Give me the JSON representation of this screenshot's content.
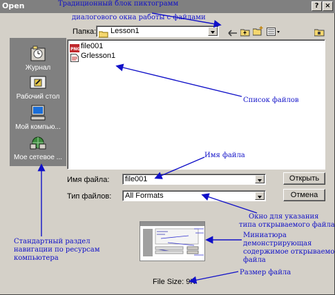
{
  "dialog": {
    "title": "Open",
    "help_glyph": "?",
    "close_glyph": "×",
    "lookin_label": "Папка:",
    "lookin_value": "Lesson1",
    "files": [
      {
        "name": "file001",
        "icon": "png-file-icon"
      },
      {
        "name": "Grlesson1",
        "icon": "document-icon"
      }
    ],
    "places": [
      "Журнал",
      "Рабочий стол",
      "Мой компью...",
      "Мое сетевое ..."
    ],
    "filename_label": "Имя файла:",
    "filename_value": "file001",
    "filetype_label": "Тип файлов:",
    "filetype_value": "All Formats",
    "open_button": "Открыть",
    "cancel_button": "Отмена",
    "file_size": "File Size: 9K"
  },
  "annotations": {
    "toolbar_line1": "Традиционный блок пиктограмм",
    "toolbar_line2": "диалогового окна работы с файлами",
    "file_list": "Список файлов",
    "file_name": "Имя файла",
    "file_type_line1": "Окно для указания",
    "file_type_line2": "типа открываемого файла",
    "nav_line1": "Стандартный раздел",
    "nav_line2": "навигации по ресурсам",
    "nav_line3": "компьютера",
    "thumb_line1": "Миниатюра",
    "thumb_line2": "демонстрирующая",
    "thumb_line3": "содержимое открываемого",
    "thumb_line4": "файла",
    "size": "Размер файла"
  },
  "colors": {
    "annotation": "#1010c8",
    "dialog_bg": "#d4d0c8",
    "titlebar": "#808080",
    "places_bar": "#808080"
  }
}
